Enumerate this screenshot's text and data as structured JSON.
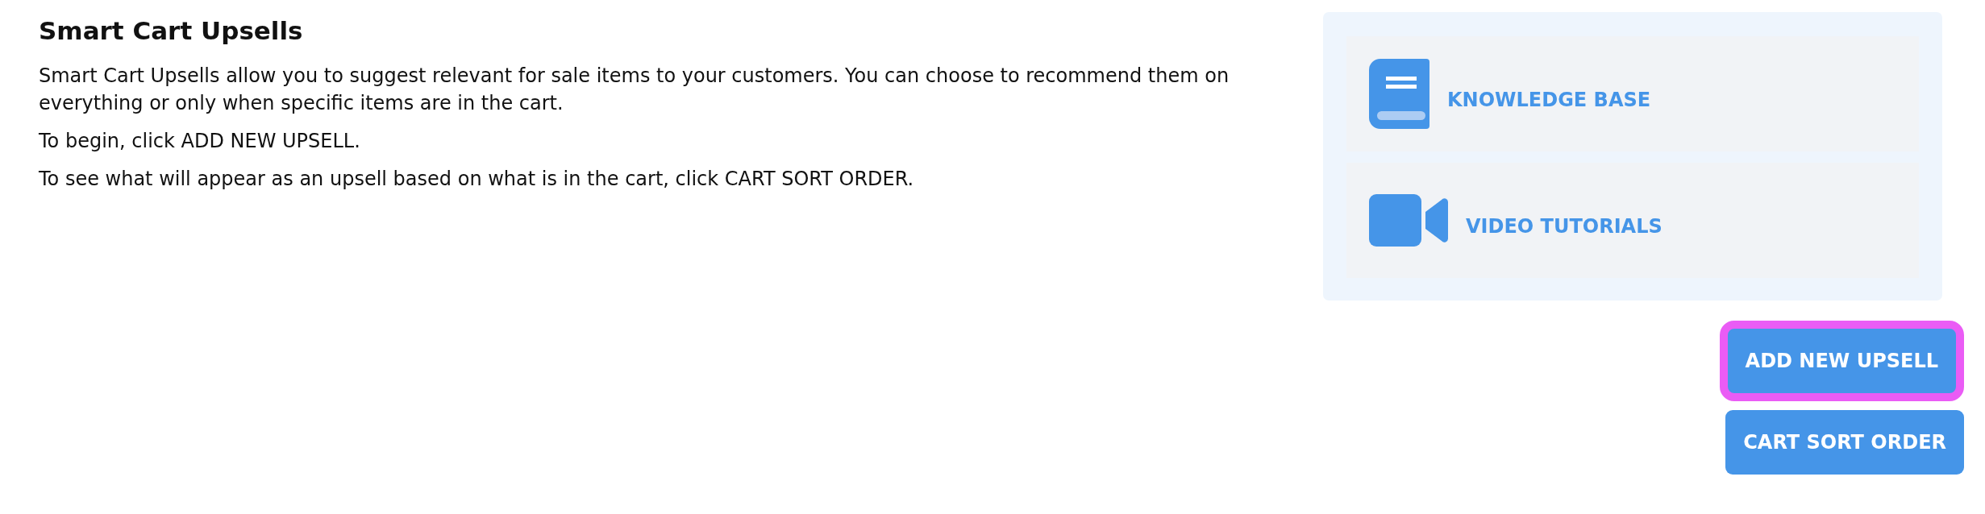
{
  "heading": "Smart Cart Upsells",
  "intro": [
    "Smart Cart Upsells allow you to suggest relevant for sale items to your customers. You can choose to recommend them on everything or only when specific items are in the cart.",
    "To begin, click ADD NEW UPSELL.",
    "To see what will appear as an upsell based on what is in the cart, click CART SORT ORDER."
  ],
  "resources": [
    {
      "kind": "book",
      "label": "KNOWLEDGE BASE"
    },
    {
      "kind": "video",
      "label": "VIDEO TUTORIALS"
    }
  ],
  "buttons": [
    {
      "label": "ADD NEW UPSELL",
      "focused": true
    },
    {
      "label": "CART SORT ORDER",
      "focused": false
    }
  ]
}
